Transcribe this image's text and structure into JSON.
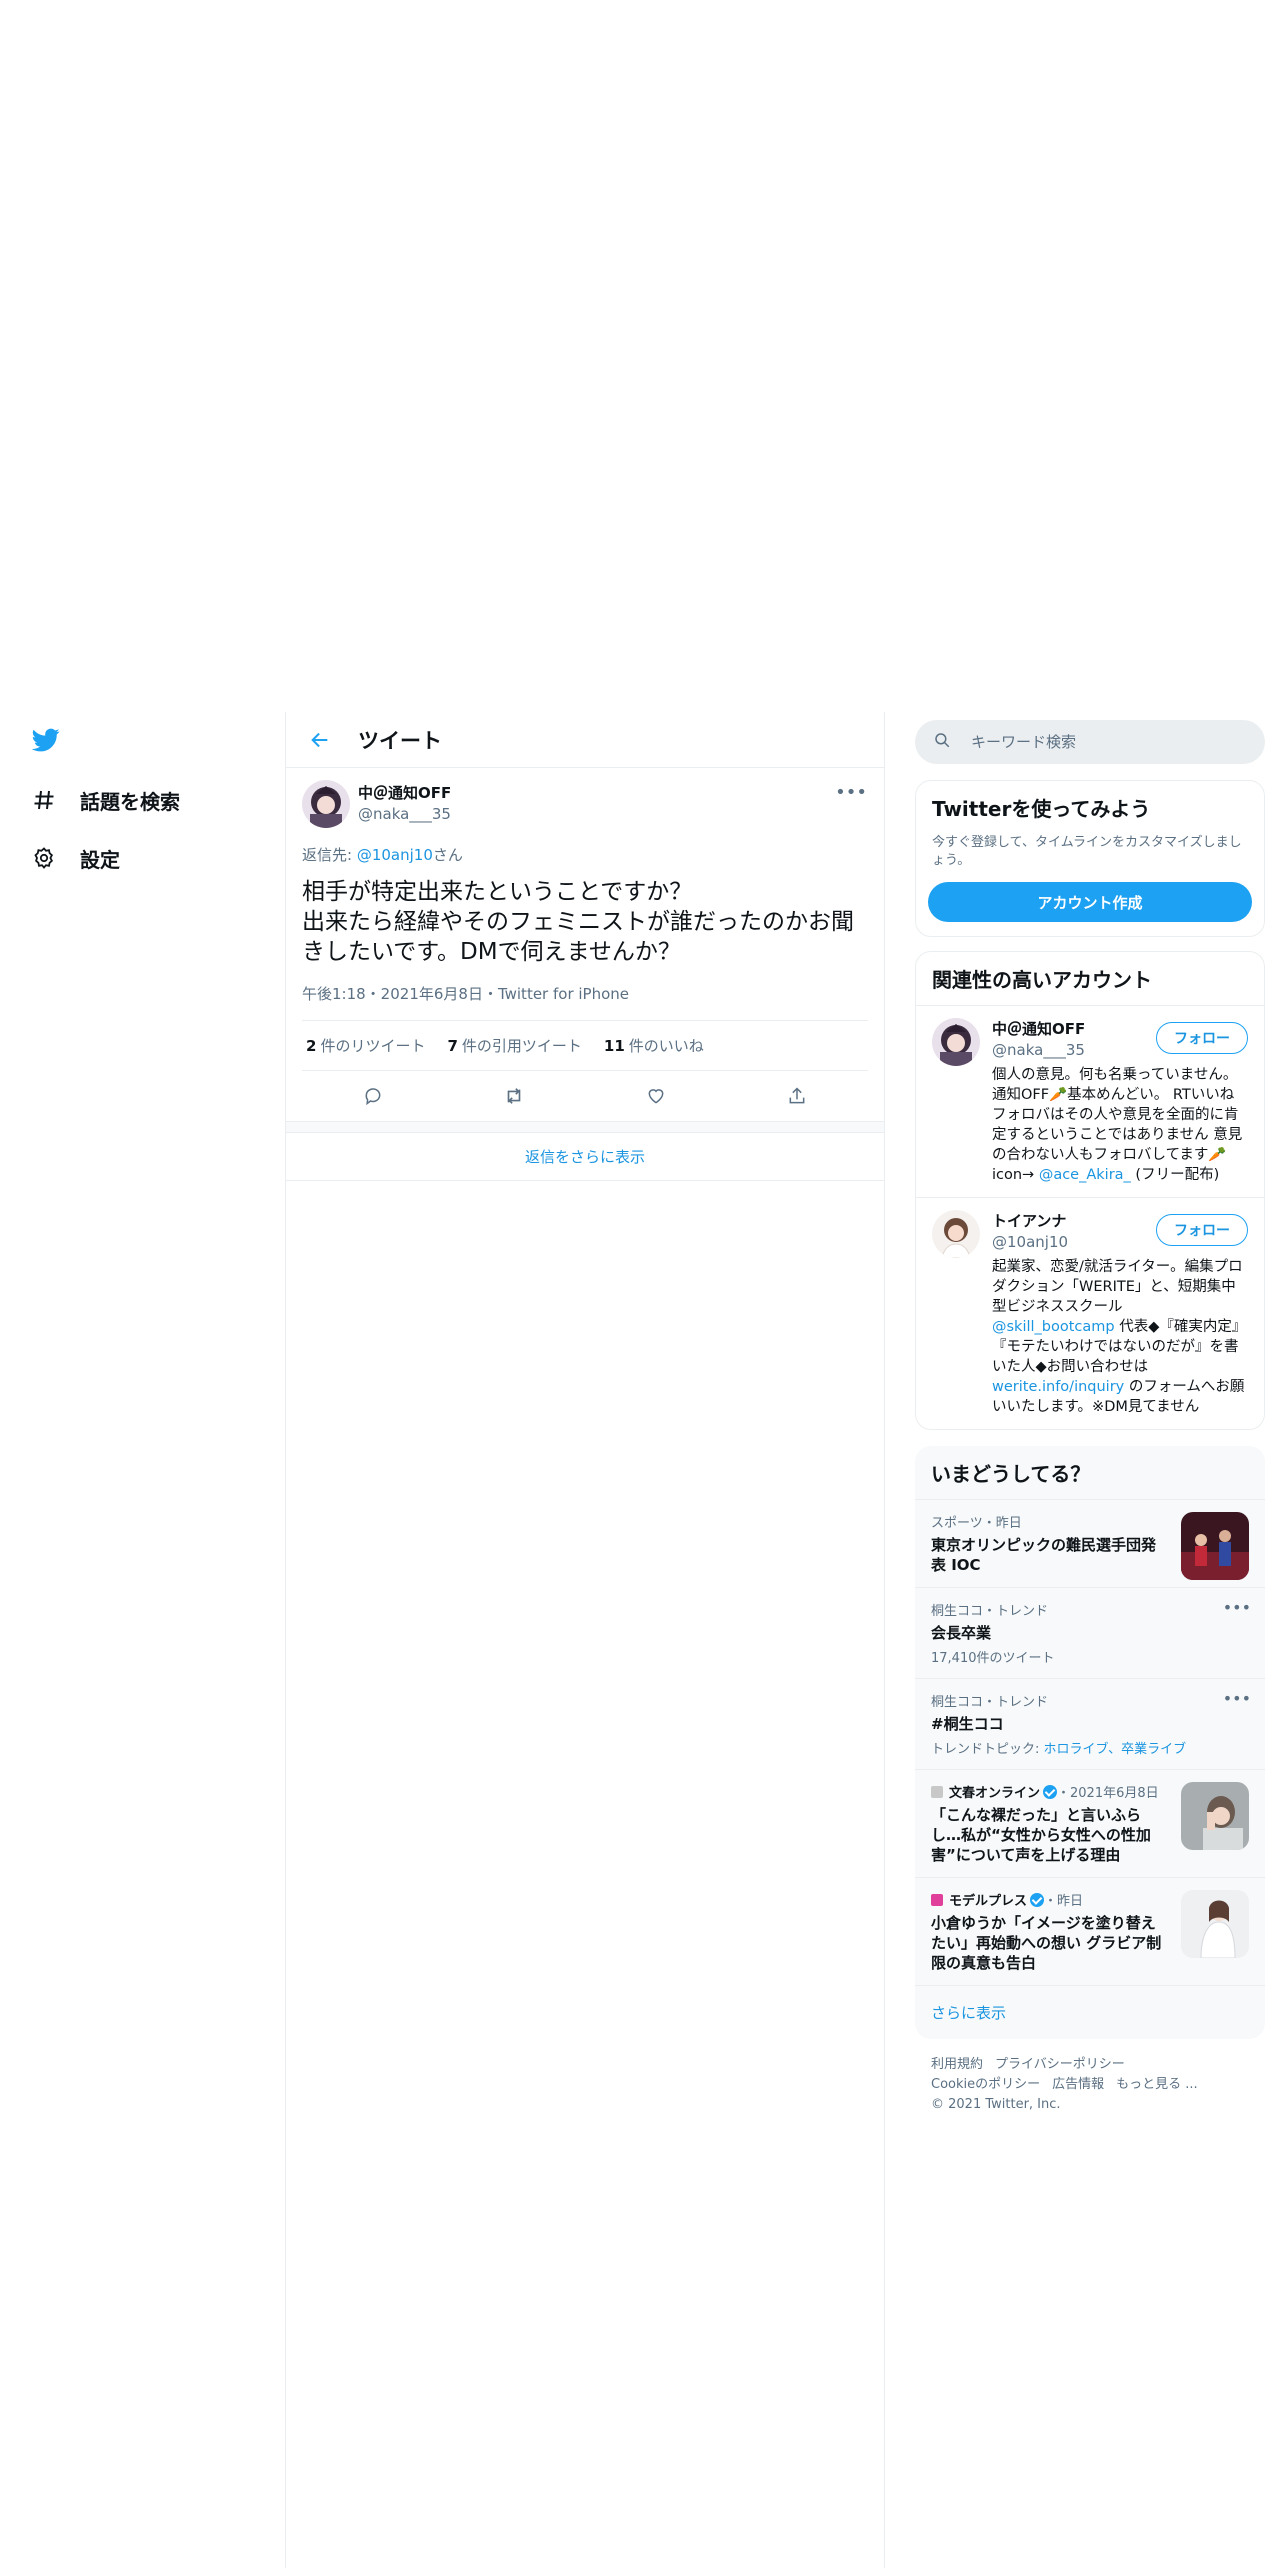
{
  "nav": {
    "items": [
      {
        "label": "話題を検索",
        "icon": "hashtag-icon"
      },
      {
        "label": "設定",
        "icon": "gear-icon"
      }
    ]
  },
  "header": {
    "title": "ツイート"
  },
  "tweet": {
    "name": "中＠通知OFF",
    "handle": "@naka___35",
    "reply_prefix": "返信先: ",
    "reply_handle": "@10anj10",
    "reply_suffix": "さん",
    "text": "相手が特定出来たということですか？\n出来たら経緯やそのフェミニストが誰だったのかお聞きしたいです。DMで伺えませんか？",
    "meta": "午後1:18・2021年6月8日・Twitter for iPhone",
    "stats": {
      "retweets_count": "2",
      "retweets_label": "件のリツイート",
      "quotes_count": "7",
      "quotes_label": "件の引用ツイート",
      "likes_count": "11",
      "likes_label": "件のいいね"
    },
    "show_more_replies": "返信をさらに表示"
  },
  "search": {
    "placeholder": "キーワード検索"
  },
  "try_card": {
    "title": "Twitterを使ってみよう",
    "desc": "今すぐ登録して、タイムラインをカスタマイズしましょう。",
    "button": "アカウント作成"
  },
  "related": {
    "title": "関連性の高いアカウント",
    "accounts": [
      {
        "name": "中＠通知OFF",
        "handle": "@naka___35",
        "follow": "フォロー",
        "bio_1": "個人の意見。何も名乗っていません。通知OFF🥕基本めんどい。 RTいいねフォロバはその人や意見を全面的に肯定するということではありません 意見の合わない人もフォロバしてます🥕icon→ ",
        "bio_link": "@ace_Akira_",
        "bio_2": " (フリー配布)"
      },
      {
        "name": "トイアンナ",
        "handle": "@10anj10",
        "follow": "フォロー",
        "bio_1": "起業家、恋愛/就活ライター。編集プロダクション「WERITE」と、短期集中型ビジネススクール ",
        "bio_link": "@skill_bootcamp",
        "bio_2": " 代表◆『確実内定』『モテたいわけではないのだが』を書いた人◆お問い合わせは ",
        "bio_link2": "werite.info/inquiry",
        "bio_3": " のフォームへお願いいたします。※DM見てません"
      }
    ]
  },
  "trends": {
    "title": "いまどうしてる？",
    "items": [
      {
        "context": "スポーツ・昨日",
        "title": "東京オリンピックの難民選手団発表 IOC"
      },
      {
        "context": "桐生ココ・トレンド",
        "title": "会長卒業",
        "sub": "17,410件のツイート"
      },
      {
        "context": "桐生ココ・トレンド",
        "title": "#桐生ココ",
        "sub_prefix": "トレンドトピック: ",
        "sub_link": "ホロライブ、卒業ライブ"
      },
      {
        "source": "文春オンライン",
        "time": "・2021年6月8日",
        "title": "「こんな裸だった」と言いふらし…私が“女性から女性への性加害”について声を上げる理由"
      },
      {
        "source": "モデルプレス",
        "time": "・昨日",
        "title": "小倉ゆうか「イメージを塗り替えたい」再始動への想い グラビア制限の真意も告白"
      }
    ],
    "show_more": "さらに表示"
  },
  "footer": {
    "links": [
      "利用規約",
      "プライバシーポリシー",
      "Cookieのポリシー",
      "広告情報",
      "もっと見る ..."
    ],
    "copyright": "© 2021 Twitter, Inc."
  },
  "colors": {
    "accent": "#1da1f2",
    "link": "#1b95e0",
    "muted": "#5b7083",
    "border": "#ebeef0"
  }
}
